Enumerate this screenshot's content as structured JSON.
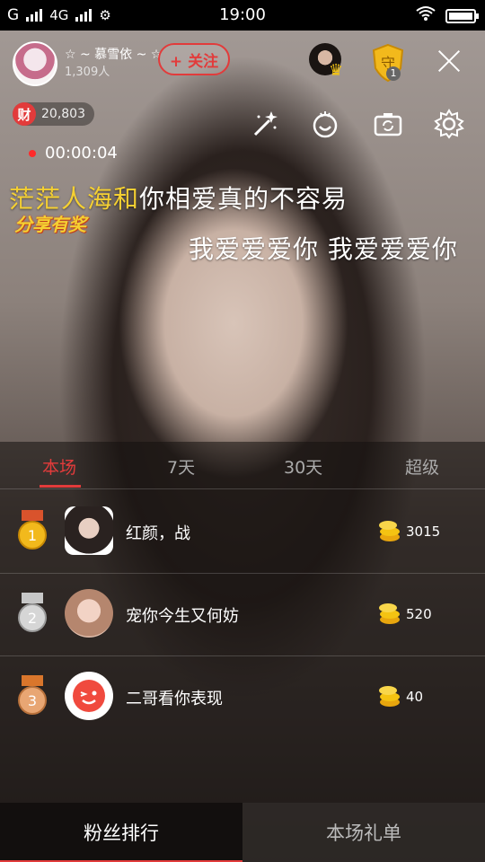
{
  "status_bar": {
    "network": "G",
    "network2": "4G",
    "time": "19:00"
  },
  "host": {
    "name": "☆ ~ 慕雪依 ~ ☆",
    "viewers": "1,309人",
    "follow_label": "+ 关注"
  },
  "viewer_badge": {
    "count": "1"
  },
  "wealth": {
    "icon_label": "财",
    "value": "20,803"
  },
  "recording": {
    "time": "00:00:04"
  },
  "lyrics": {
    "line1_highlight": "茫茫人海和",
    "line1_rest": "你相爱真的不容易",
    "line2": "我爱爱爱你 我爱爱爱你"
  },
  "share_badge": "分享有奖",
  "ranking": {
    "tabs": [
      "本场",
      "7天",
      "30天",
      "超级"
    ],
    "rows": [
      {
        "rank": "1",
        "name": "红颜，战",
        "score": "3015"
      },
      {
        "rank": "2",
        "name": "宠你今生又何妨",
        "score": "520"
      },
      {
        "rank": "3",
        "name": "二哥看你表现",
        "score": "40"
      }
    ]
  },
  "bottom_tabs": {
    "fans": "粉丝排行",
    "gifts": "本场礼单"
  },
  "colors": {
    "accent": "#e23b3b",
    "gold": "#f5d032"
  }
}
